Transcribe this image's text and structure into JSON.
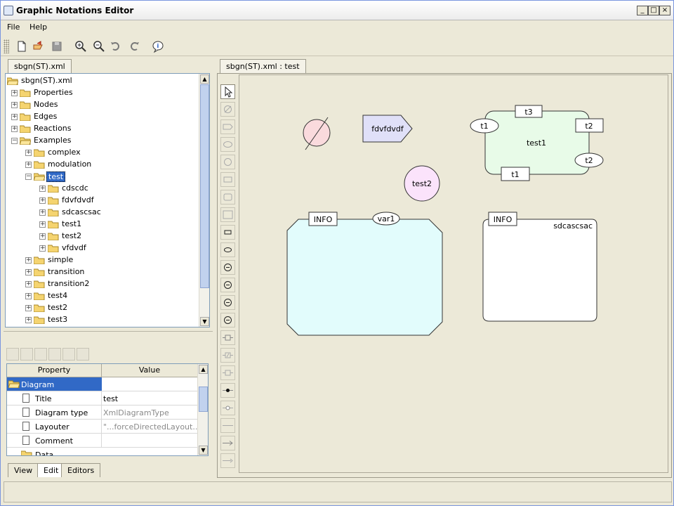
{
  "window": {
    "title": "Graphic Notations Editor"
  },
  "menu": [
    "File",
    "Help"
  ],
  "toolbar": {
    "icons": [
      "new-file-icon",
      "open-file-icon",
      "save-icon",
      "zoom-in-icon",
      "zoom-out-icon",
      "undo-icon",
      "redo-icon",
      "info-icon"
    ]
  },
  "left_tab": "sbgn(ST).xml",
  "tree": {
    "root": "sbgn(ST).xml",
    "items": [
      "Properties",
      "Nodes",
      "Edges",
      "Reactions",
      "Examples",
      "complex",
      "modulation",
      "test",
      "cdscdc",
      "fdvfdvdf",
      "sdcascsac",
      "test1",
      "test2",
      "vfdvdf",
      "simple",
      "transition",
      "transition2",
      "test4",
      "test2",
      "test3"
    ]
  },
  "properties": {
    "headers": {
      "property": "Property",
      "value": "Value"
    },
    "group": "Diagram",
    "rows": [
      {
        "name": "Title",
        "value": "test"
      },
      {
        "name": "Diagram type",
        "value": "XmlDiagramType"
      },
      {
        "name": "Layouter",
        "value": "\"...forceDirectedLayout...\""
      },
      {
        "name": "Comment",
        "value": ""
      }
    ],
    "next_group": "Data"
  },
  "bottom_tabs": [
    "View",
    "Edit",
    "Editors"
  ],
  "editor_tab": "sbgn(ST).xml : test",
  "diagram": {
    "node_fdv": "fdvfdvdf",
    "node_test1": "test1",
    "port_t3": "t3",
    "port_t1_left": "t1",
    "port_t2_right": "t2",
    "port_t2_ellipse": "t2",
    "port_t1_bottom": "t1",
    "node_test2": "test2",
    "info1": "INFO",
    "var1": "var1",
    "info2": "INFO",
    "node_sdc": "sdcascsac"
  },
  "colors": {
    "accent": "#3169c6",
    "source_sink": "#fadadd",
    "macromolecule": "#e0e0f8",
    "compartment_green": "#e8fbe8",
    "complex_cyan": "#e2fcfc",
    "simple_pink": "#fbe3fb"
  }
}
